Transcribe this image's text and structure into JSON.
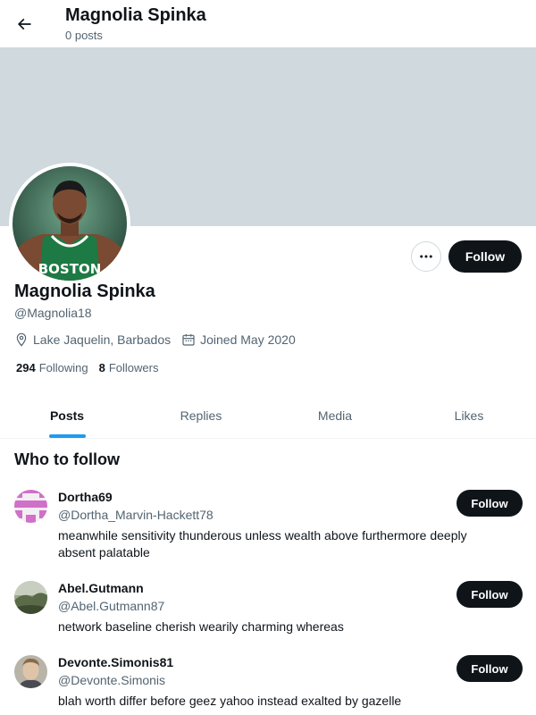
{
  "header": {
    "title": "Magnolia Spinka",
    "subtitle": "0 posts",
    "back_icon": "arrow-left-icon"
  },
  "profile": {
    "name": "Magnolia Spinka",
    "handle": "@Magnolia18",
    "location": "Lake Jaquelin, Barbados",
    "joined": "Joined May 2020",
    "following_count": "294",
    "following_label": "Following",
    "followers_count": "8",
    "followers_label": "Followers",
    "follow_label": "Follow",
    "avatar_jersey_text": "BOSTON",
    "colors": {
      "banner": "#cfd9de",
      "jersey": "#1d7a44",
      "accent": "#1d9bf0"
    }
  },
  "tabs": [
    {
      "label": "Posts",
      "active": true
    },
    {
      "label": "Replies",
      "active": false
    },
    {
      "label": "Media",
      "active": false
    },
    {
      "label": "Likes",
      "active": false
    }
  ],
  "who_to_follow": {
    "title": "Who to follow",
    "items": [
      {
        "name": "Dortha69",
        "handle": "@Dortha_Marvin-Hackett78",
        "bio": "meanwhile sensitivity thunderous unless wealth above furthermore deeply absent palatable",
        "button": "Follow"
      },
      {
        "name": "Abel.Gutmann",
        "handle": "@Abel.Gutmann87",
        "bio": "network baseline cherish wearily charming whereas",
        "button": "Follow"
      },
      {
        "name": "Devonte.Simonis81",
        "handle": "@Devonte.Simonis",
        "bio": "blah worth differ before geez yahoo instead exalted by gazelle",
        "button": "Follow"
      }
    ]
  }
}
